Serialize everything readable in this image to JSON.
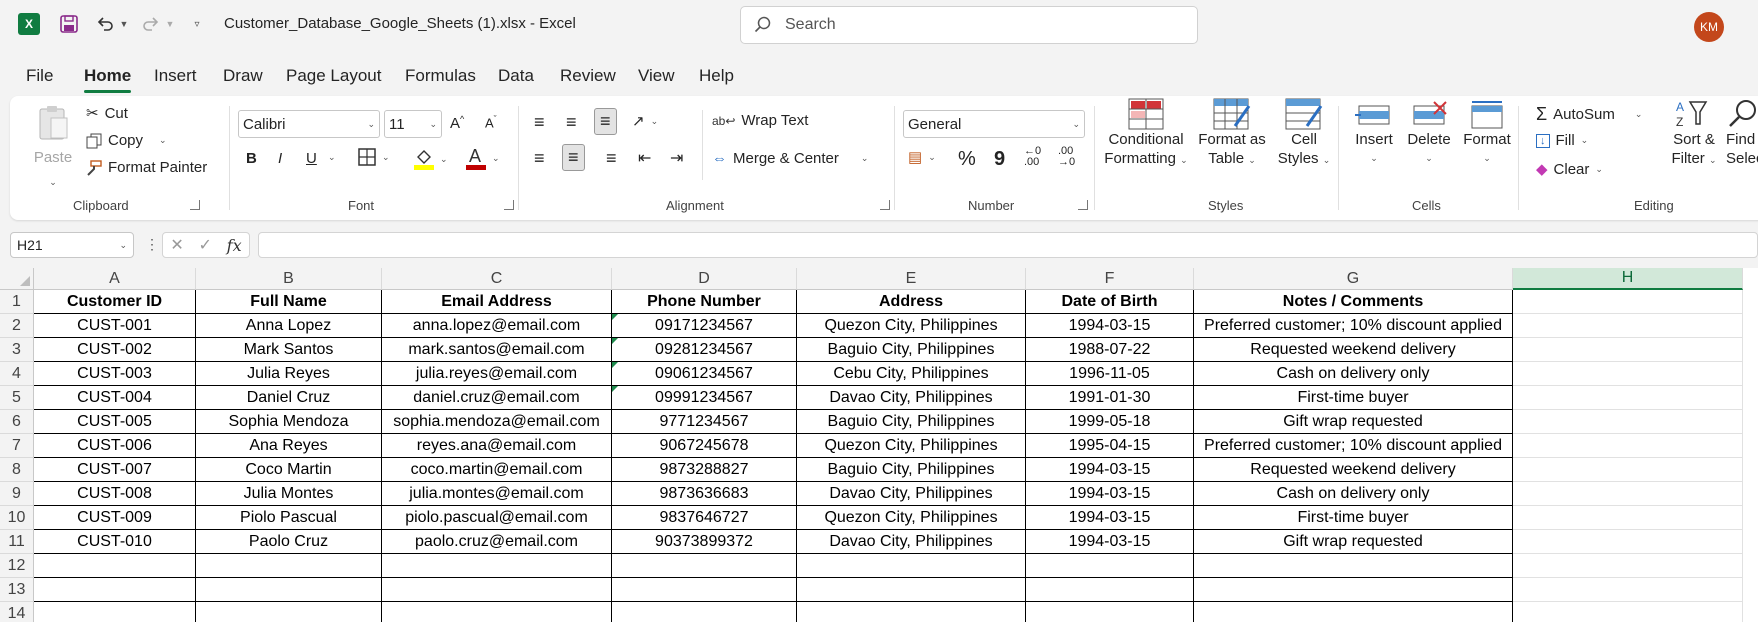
{
  "window": {
    "doc_title": "Customer_Database_Google_Sheets (1).xlsx  -  Excel",
    "search_placeholder": "Search",
    "avatar_initials": "KM",
    "app_icon_letter": "X"
  },
  "menu_tabs": [
    "File",
    "Home",
    "Insert",
    "Draw",
    "Page Layout",
    "Formulas",
    "Data",
    "Review",
    "View",
    "Help"
  ],
  "active_tab": "Home",
  "ribbon": {
    "clipboard": {
      "paste": "Paste",
      "cut": "Cut",
      "copy": "Copy",
      "format_painter": "Format Painter",
      "label": "Clipboard"
    },
    "font": {
      "font_name": "Calibri",
      "font_size": "11",
      "bold": "B",
      "italic": "I",
      "underline": "U",
      "label": "Font"
    },
    "alignment": {
      "wrap_text": "Wrap Text",
      "merge_center": "Merge & Center",
      "label": "Alignment"
    },
    "number": {
      "format": "General",
      "percent": "%",
      "comma": "9",
      "label": "Number"
    },
    "styles": {
      "conditional_1": "Conditional",
      "conditional_2": "Formatting",
      "format_table_1": "Format as",
      "format_table_2": "Table",
      "cell_styles_1": "Cell",
      "cell_styles_2": "Styles",
      "label": "Styles"
    },
    "cells": {
      "insert": "Insert",
      "delete": "Delete",
      "format": "Format",
      "label": "Cells"
    },
    "editing": {
      "autosum": "AutoSum",
      "fill": "Fill",
      "clear": "Clear",
      "sort_1": "Sort &",
      "sort_2": "Filter",
      "find_1": "Find",
      "find_2": "Selec",
      "label": "Editing"
    }
  },
  "formula_bar": {
    "name_box": "H21",
    "fx": "fx",
    "value": ""
  },
  "sheet": {
    "columns": [
      "A",
      "B",
      "C",
      "D",
      "E",
      "F",
      "G",
      "H"
    ],
    "selected_column": "H",
    "row_numbers": [
      "1",
      "2",
      "3",
      "4",
      "5",
      "6",
      "7",
      "8",
      "9",
      "10",
      "11",
      "12",
      "13",
      "14"
    ],
    "rows": [
      [
        "Customer ID",
        "Full Name",
        "Email Address",
        "Phone Number",
        "Address",
        "Date of Birth",
        "Notes / Comments",
        ""
      ],
      [
        "CUST-001",
        "Anna Lopez",
        "anna.lopez@email.com",
        "09171234567",
        "Quezon City, Philippines",
        "1994-03-15",
        "Preferred customer; 10% discount applied",
        ""
      ],
      [
        "CUST-002",
        "Mark Santos",
        "mark.santos@email.com",
        "09281234567",
        "Baguio City, Philippines",
        "1988-07-22",
        "Requested weekend delivery",
        ""
      ],
      [
        "CUST-003",
        "Julia Reyes",
        "julia.reyes@email.com",
        "09061234567",
        "Cebu City, Philippines",
        "1996-11-05",
        "Cash on delivery only",
        ""
      ],
      [
        "CUST-004",
        "Daniel Cruz",
        "daniel.cruz@email.com",
        "09991234567",
        "Davao City, Philippines",
        "1991-01-30",
        "First-time buyer",
        ""
      ],
      [
        "CUST-005",
        "Sophia Mendoza",
        "sophia.mendoza@email.com",
        "9771234567",
        "Baguio City, Philippines",
        "1999-05-18",
        "Gift wrap requested",
        ""
      ],
      [
        "CUST-006",
        "Ana Reyes",
        "reyes.ana@email.com",
        "9067245678",
        "Quezon City, Philippines",
        "1995-04-15",
        "Preferred customer; 10% discount applied",
        ""
      ],
      [
        "CUST-007",
        "Coco Martin",
        "coco.martin@email.com",
        "9873288827",
        "Baguio City, Philippines",
        "1994-03-15",
        "Requested weekend delivery",
        ""
      ],
      [
        "CUST-008",
        "Julia Montes",
        "julia.montes@email.com",
        "9873636683",
        "Davao City, Philippines",
        "1994-03-15",
        "Cash on delivery only",
        ""
      ],
      [
        "CUST-009",
        "Piolo Pascual",
        "piolo.pascual@email.com",
        "9837646727",
        "Quezon City, Philippines",
        "1994-03-15",
        "First-time buyer",
        ""
      ],
      [
        "CUST-010",
        "Paolo Cruz",
        "paolo.cruz@email.com",
        "90373899372",
        "Davao City, Philippines",
        "1994-03-15",
        "Gift wrap requested",
        ""
      ],
      [
        "",
        "",
        "",
        "",
        "",
        "",
        "",
        ""
      ],
      [
        "",
        "",
        "",
        "",
        "",
        "",
        "",
        ""
      ],
      [
        "",
        "",
        "",
        "",
        "",
        "",
        "",
        ""
      ]
    ],
    "text_number_flag_rows": [
      2,
      3,
      4,
      5
    ],
    "accent_color": "#107c41"
  }
}
